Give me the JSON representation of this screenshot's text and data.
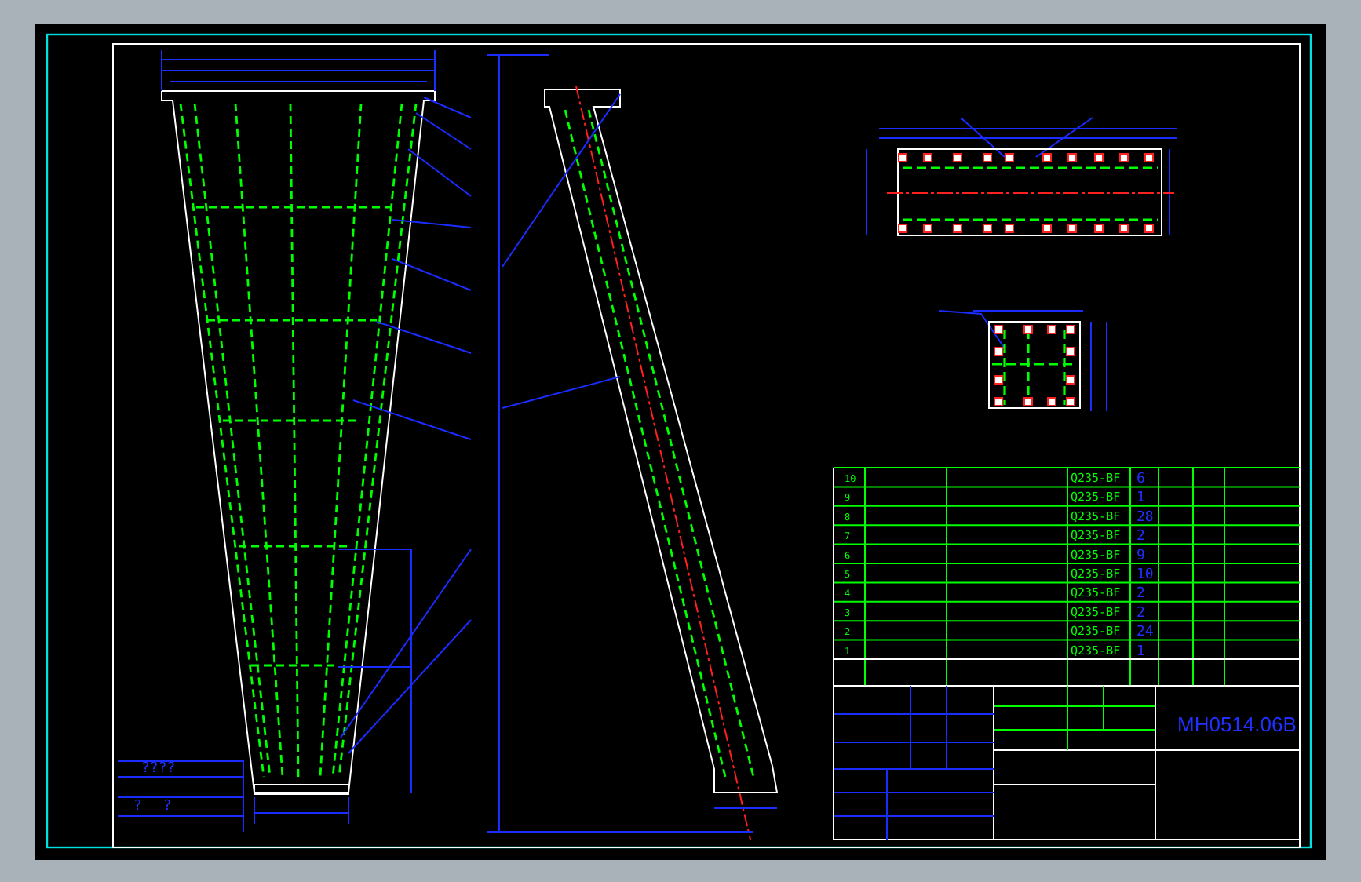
{
  "parts_list": {
    "rows": [
      {
        "no": "10",
        "material": "Q235-BF",
        "quantity": "6"
      },
      {
        "no": "9",
        "material": "Q235-BF",
        "quantity": "1"
      },
      {
        "no": "8",
        "material": "Q235-BF",
        "quantity": "28"
      },
      {
        "no": "7",
        "material": "Q235-BF",
        "quantity": "2"
      },
      {
        "no": "6",
        "material": "Q235-BF",
        "quantity": "9"
      },
      {
        "no": "5",
        "material": "Q235-BF",
        "quantity": "10"
      },
      {
        "no": "4",
        "material": "Q235-BF",
        "quantity": "2"
      },
      {
        "no": "3",
        "material": "Q235-BF",
        "quantity": "2"
      },
      {
        "no": "2",
        "material": "Q235-BF",
        "quantity": "24"
      },
      {
        "no": "1",
        "material": "Q235-BF",
        "quantity": "1"
      }
    ]
  },
  "title_block": {
    "drawing_number": "MH0514.06B"
  },
  "side_block": {
    "texts": [
      "????",
      "? ?"
    ]
  }
}
